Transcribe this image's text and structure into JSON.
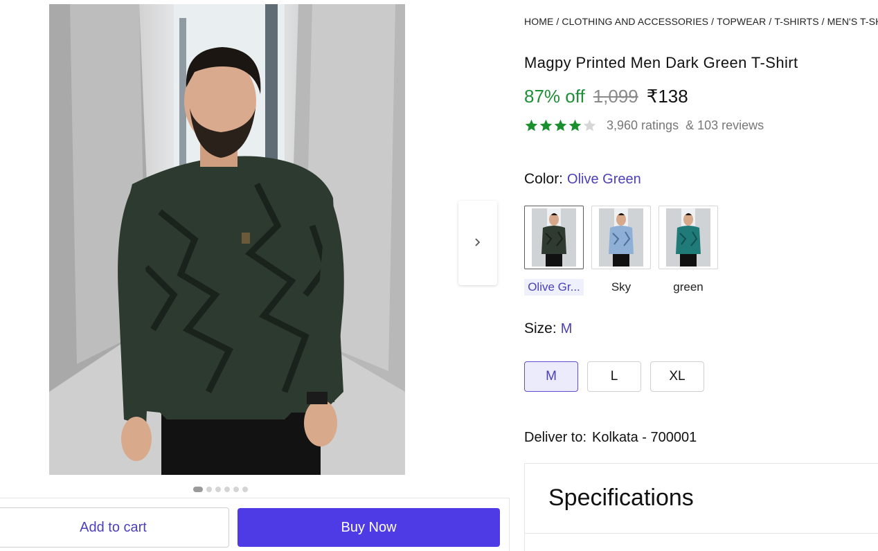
{
  "breadcrumb": {
    "items": [
      "HOME",
      "CLOTHING AND ACCESSORIES",
      "TOPWEAR",
      "T-SHIRTS",
      "MEN'S T-SH"
    ],
    "separator": "/"
  },
  "product": {
    "title": "Magpy Printed Men Dark Green T-Shirt",
    "discount": "87% off",
    "mrp": "1,099",
    "price": "₹138",
    "rating": {
      "stars": 4,
      "max_stars": 5,
      "ratings_text": "3,960 ratings",
      "reviews_text": "& 103 reviews"
    }
  },
  "gallery": {
    "dot_count": 6,
    "active_dot": 1,
    "next_icon": "chevron-right-icon"
  },
  "color": {
    "label": "Color:",
    "selected": "Olive Green",
    "options": [
      {
        "name": "Olive Gr...",
        "shirt_color": "#2f3a30",
        "pattern_color": "#1a201b"
      },
      {
        "name": "Sky",
        "shirt_color": "#8fb0d6",
        "pattern_color": "#4f6f98"
      },
      {
        "name": "green",
        "shirt_color": "#1f7a78",
        "pattern_color": "#10514f"
      }
    ]
  },
  "size": {
    "label": "Size:",
    "selected": "M",
    "options": [
      "M",
      "L",
      "XL"
    ]
  },
  "delivery": {
    "label": "Deliver to:",
    "location": "Kolkata - 700001"
  },
  "specifications": {
    "title": "Specifications"
  },
  "actions": {
    "add_to_cart": "Add to cart",
    "buy_now": "Buy Now"
  },
  "colors": {
    "accent": "#4f3be6",
    "link": "#4b3fb9",
    "discount_green": "#1f8f37",
    "star_green": "#1a8f2d"
  }
}
